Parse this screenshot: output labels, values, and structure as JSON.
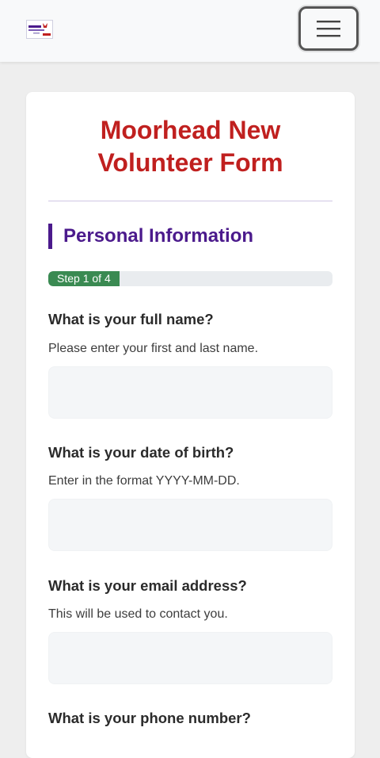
{
  "header": {
    "menu_icon": "hamburger-icon"
  },
  "form": {
    "title_line1": "Moorhead New",
    "title_line2": "Volunteer Form",
    "section_title": "Personal Information",
    "progress": {
      "label": "Step 1 of 4",
      "fraction": 0.25
    },
    "questions": [
      {
        "label": "What is your full name?",
        "help": "Please enter your first and last name.",
        "value": ""
      },
      {
        "label": "What is your date of birth?",
        "help": "Enter in the format YYYY-MM-DD.",
        "value": ""
      },
      {
        "label": "What is your email address?",
        "help": "This will be used to contact you.",
        "value": ""
      },
      {
        "label": "What is your phone number?"
      }
    ]
  },
  "colors": {
    "title": "#c0201f",
    "section": "#4b1a8c",
    "progress": "#3a8a52"
  }
}
